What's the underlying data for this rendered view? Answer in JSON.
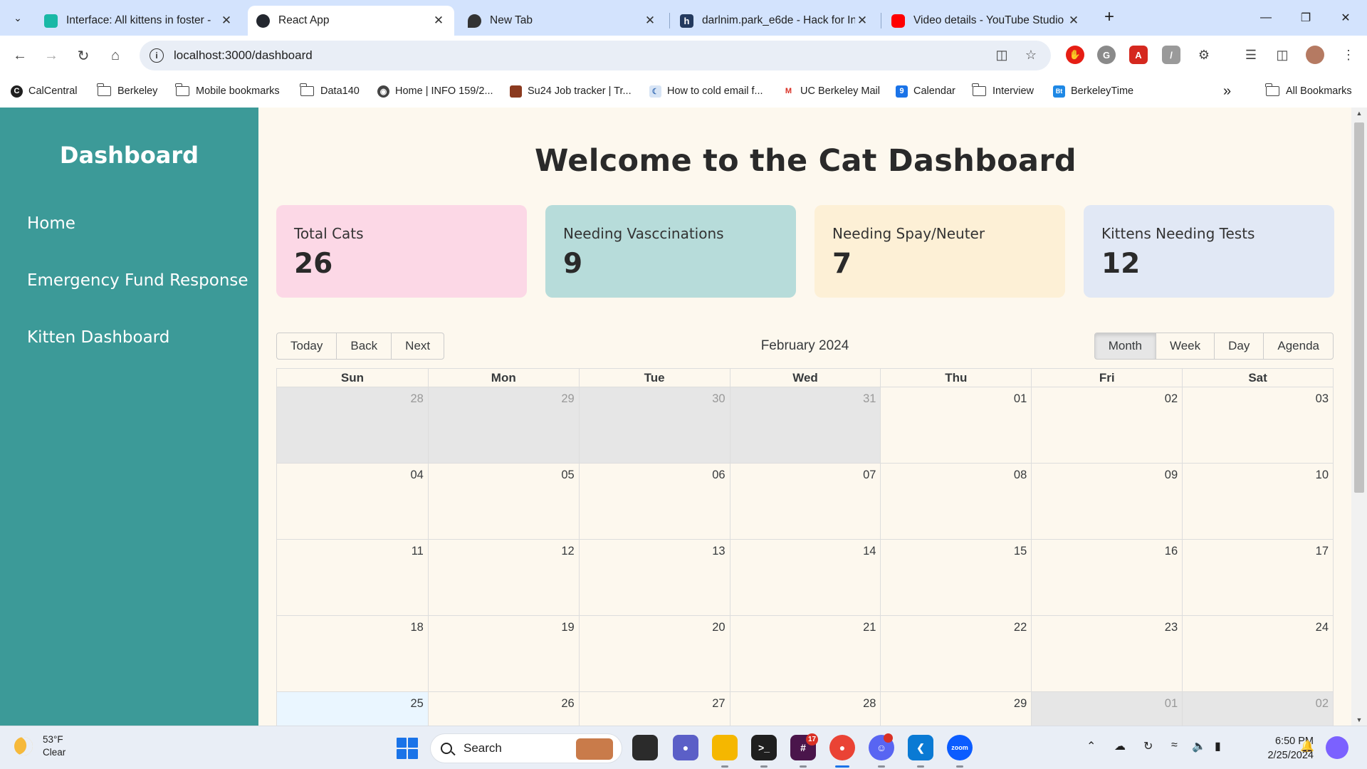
{
  "browser": {
    "tabs": [
      {
        "title": "Interface: All kittens in foster - ",
        "favicon_color": "#19b8a6"
      },
      {
        "title": "React App",
        "favicon_color": "#23272f"
      },
      {
        "title": "New Tab",
        "favicon_color": "#333333"
      },
      {
        "title": "darlnim.park_e6de - Hack for In",
        "favicon_color": "#243a5e"
      },
      {
        "title": "Video details - YouTube Studio",
        "favicon_color": "#ff0000"
      }
    ],
    "new_tab_label": "+",
    "address": "localhost:3000/dashboard",
    "bookmarks": [
      {
        "label": "CalCentral",
        "icon": "calcentral-icon"
      },
      {
        "label": "Berkeley",
        "icon": "folder-icon"
      },
      {
        "label": "Mobile bookmarks",
        "icon": "folder-icon"
      },
      {
        "label": "Data140",
        "icon": "folder-icon"
      },
      {
        "label": "Home | INFO 159/2...",
        "icon": "globe-icon"
      },
      {
        "label": "Su24 Job tracker | Tr...",
        "icon": "briefcase-icon"
      },
      {
        "label": "How to cold email f...",
        "icon": "moon-icon"
      },
      {
        "label": "UC Berkeley Mail",
        "icon": "gmail-icon"
      },
      {
        "label": "Calendar",
        "icon": "calendar-icon"
      },
      {
        "label": "Interview",
        "icon": "folder-icon"
      },
      {
        "label": "BerkeleyTime",
        "icon": "berkeleytime-icon"
      }
    ],
    "more_bookmarks": "»",
    "all_bookmarks": "All Bookmarks"
  },
  "sidebar": {
    "title": "Dashboard",
    "items": [
      "Home",
      "Emergency Fund Response",
      "Kitten Dashboard"
    ]
  },
  "main": {
    "heading": "Welcome to the Cat Dashboard",
    "cards": [
      {
        "label": "Total Cats",
        "value": "26",
        "color": "#fcd8e6"
      },
      {
        "label": "Needing Vasccinations",
        "value": "9",
        "color": "#b7dcda"
      },
      {
        "label": "Needing Spay/Neuter",
        "value": "7",
        "color": "#fdf0d6"
      },
      {
        "label": "Kittens Needing Tests",
        "value": "12",
        "color": "#e1e8f5"
      }
    ]
  },
  "calendar": {
    "nav_buttons": [
      "Today",
      "Back",
      "Next"
    ],
    "label": "February 2024",
    "view_buttons": [
      "Month",
      "Week",
      "Day",
      "Agenda"
    ],
    "active_view": "Month",
    "weekdays": [
      "Sun",
      "Mon",
      "Tue",
      "Wed",
      "Thu",
      "Fri",
      "Sat"
    ],
    "weeks": [
      [
        {
          "d": "28",
          "off": true
        },
        {
          "d": "29",
          "off": true
        },
        {
          "d": "30",
          "off": true
        },
        {
          "d": "31",
          "off": true
        },
        {
          "d": "01"
        },
        {
          "d": "02"
        },
        {
          "d": "03"
        }
      ],
      [
        {
          "d": "04"
        },
        {
          "d": "05"
        },
        {
          "d": "06"
        },
        {
          "d": "07"
        },
        {
          "d": "08"
        },
        {
          "d": "09"
        },
        {
          "d": "10"
        }
      ],
      [
        {
          "d": "11"
        },
        {
          "d": "12"
        },
        {
          "d": "13"
        },
        {
          "d": "14"
        },
        {
          "d": "15"
        },
        {
          "d": "16"
        },
        {
          "d": "17"
        }
      ],
      [
        {
          "d": "18"
        },
        {
          "d": "19"
        },
        {
          "d": "20"
        },
        {
          "d": "21"
        },
        {
          "d": "22"
        },
        {
          "d": "23"
        },
        {
          "d": "24"
        }
      ],
      [
        {
          "d": "25",
          "today": true
        },
        {
          "d": "26"
        },
        {
          "d": "27"
        },
        {
          "d": "28"
        },
        {
          "d": "29"
        },
        {
          "d": "01",
          "off": true
        },
        {
          "d": "02",
          "off": true
        }
      ]
    ]
  },
  "taskbar": {
    "weather_temp": "53°F",
    "weather_cond": "Clear",
    "search_label": "Search",
    "slack_badge": "17",
    "zoom_label": "zoom",
    "time": "6:50 PM",
    "date": "2/25/2024"
  }
}
